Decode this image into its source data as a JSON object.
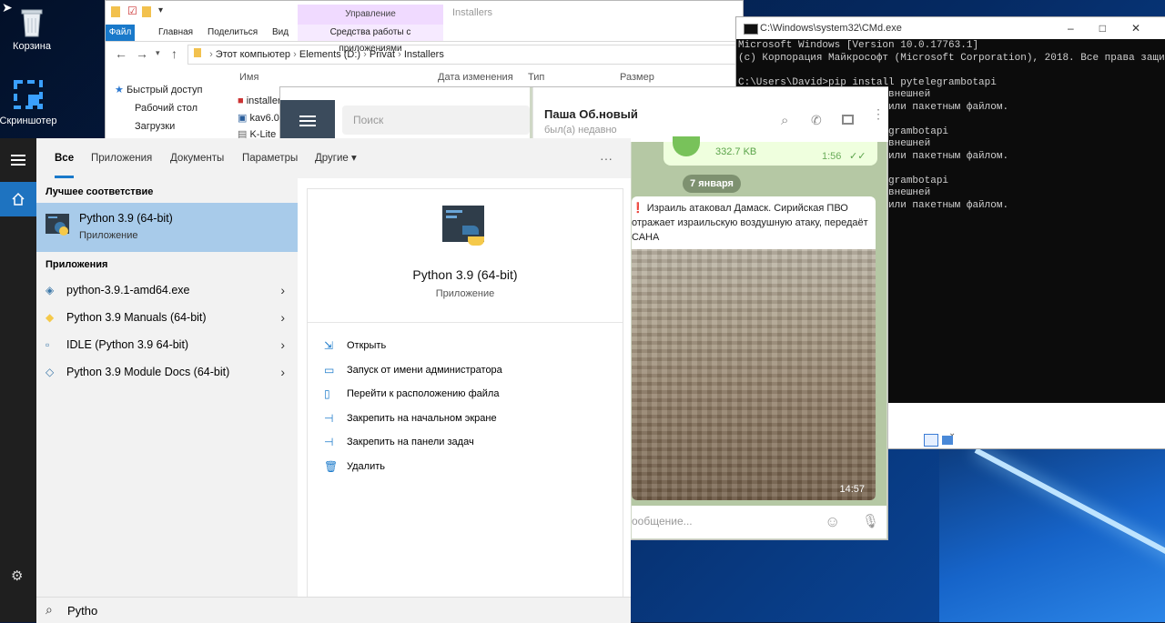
{
  "desktop": {
    "icons": [
      {
        "label": "Корзина",
        "icon": "recycle-bin-icon"
      },
      {
        "label": "Скриншотер",
        "icon": "screenshot-tool-icon"
      }
    ]
  },
  "explorer": {
    "context_header": "Управление",
    "context_tab": "Средства работы с приложениями",
    "path_title": "Installers",
    "tabs": [
      "Файл",
      "Главная",
      "Поделиться",
      "Вид"
    ],
    "breadcrumb": [
      "Этот компьютер",
      "Elements (D:)",
      "Privat",
      "Installers"
    ],
    "sidebar": [
      "Быстрый доступ",
      "Рабочий стол",
      "Загрузки"
    ],
    "columns": [
      "Имя",
      "Дата изменения",
      "Тип",
      "Размер"
    ],
    "files": [
      "install",
      "installer",
      "kav6.0",
      "K-Lite"
    ]
  },
  "cmd": {
    "title": "C:\\Windows\\system32\\CMd.exe",
    "lines": [
      "Microsoft Windows [Version 10.0.17763.1]",
      "(c) Корпорация Майкрософт (Microsoft Corporation), 2018. Все права защищены.",
      "",
      "C:\\Users\\David>pip install pytelegrambotapi",
      "                   й или внешней",
      "                   аммой или пакетным файлом.",
      "",
      "                   pytelegrambotapi",
      "                   й или внешней",
      "                   аммой или пакетным файлом.",
      "",
      "                   pytelegrambotapi",
      "                   й или внешней",
      "                   аммой или пакетным файлом."
    ]
  },
  "telegram": {
    "search_placeholder": "Поиск",
    "chat_name": "Паша Об.новый",
    "chat_status": "был(а) недавно",
    "file_size": "332.7 KB",
    "file_time": "1:56",
    "date_badge": "7 января",
    "message": "❗ Израиль атаковал Дамаск. Сирийская ПВО отражает израильскую воздушную атаку, передаёт САНА",
    "photo_time": "14:57",
    "input_placeholder": "ообщение..."
  },
  "start": {
    "tabs": [
      "Все",
      "Приложения",
      "Документы",
      "Параметры",
      "Другие"
    ],
    "best_match_heading": "Лучшее соответствие",
    "best_match": {
      "title": "Python 3.9 (64-bit)",
      "subtitle": "Приложение"
    },
    "apps_heading": "Приложения",
    "apps": [
      "python-3.9.1-amd64.exe",
      "Python 3.9 Manuals (64-bit)",
      "IDLE (Python 3.9 64-bit)",
      "Python 3.9 Module Docs (64-bit)"
    ],
    "detail": {
      "title": "Python 3.9 (64-bit)",
      "subtitle": "Приложение",
      "actions": [
        {
          "label": "Открыть",
          "icon": "open-icon"
        },
        {
          "label": "Запуск от имени администратора",
          "icon": "run-as-admin-icon"
        },
        {
          "label": "Перейти к расположению файла",
          "icon": "file-location-icon"
        },
        {
          "label": "Закрепить на начальном экране",
          "icon": "pin-start-icon"
        },
        {
          "label": "Закрепить на панели задач",
          "icon": "pin-taskbar-icon"
        },
        {
          "label": "Удалить",
          "icon": "trash-icon"
        }
      ]
    },
    "search_query": "Pytho",
    "accent": "#1979ca"
  }
}
